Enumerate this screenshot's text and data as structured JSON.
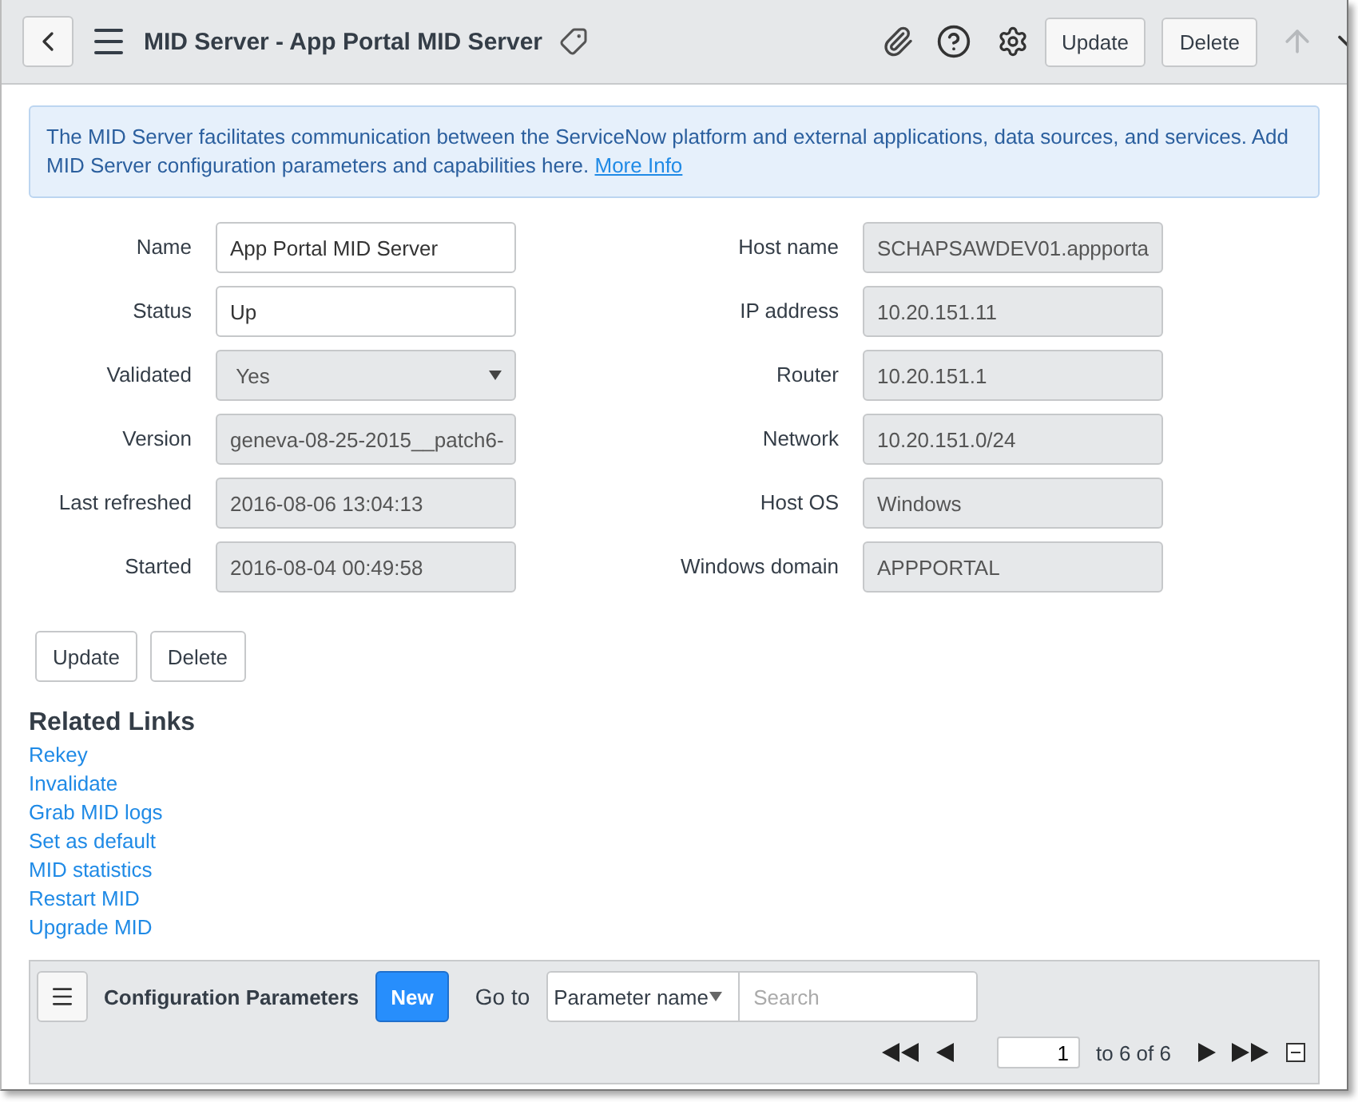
{
  "header": {
    "title": "MID Server - App Portal MID Server",
    "buttons": [
      "Update",
      "Delete"
    ]
  },
  "info": {
    "text": "The MID Server facilitates communication between the ServiceNow platform and external applications, data sources, and services. Add MID Server configuration parameters and capabilities here.",
    "link": "More Info"
  },
  "left_fields": [
    {
      "label": "Name",
      "value": "App Portal MID Server",
      "kind": "input"
    },
    {
      "label": "Status",
      "value": "Up",
      "kind": "input"
    },
    {
      "label": "Validated",
      "value": "Yes",
      "kind": "select"
    },
    {
      "label": "Version",
      "value": "geneva-08-25-2015__patch6-",
      "kind": "readonly"
    },
    {
      "label": "Last refreshed",
      "value": "2016-08-06 13:04:13",
      "kind": "readonly"
    },
    {
      "label": "Started",
      "value": "2016-08-04 00:49:58",
      "kind": "readonly"
    }
  ],
  "right_fields": [
    {
      "label": "Host name",
      "value": "SCHAPSAWDEV01.appporta",
      "kind": "readonly"
    },
    {
      "label": "IP address",
      "value": "10.20.151.11",
      "kind": "readonly"
    },
    {
      "label": "Router",
      "value": "10.20.151.1",
      "kind": "readonly"
    },
    {
      "label": "Network",
      "value": "10.20.151.0/24",
      "kind": "readonly"
    },
    {
      "label": "Host OS",
      "value": "Windows",
      "kind": "readonly"
    },
    {
      "label": "Windows domain",
      "value": "APPPORTAL",
      "kind": "readonly"
    }
  ],
  "form_buttons": [
    "Update",
    "Delete"
  ],
  "related_links": {
    "title": "Related Links",
    "items": [
      "Rekey",
      "Invalidate",
      "Grab MID logs",
      "Set as default",
      "MID statistics",
      "Restart MID",
      "Upgrade MID"
    ]
  },
  "list_panel": {
    "title": "Configuration Parameters",
    "new_button": "New",
    "goto_label": "Go to",
    "goto_field": "Parameter name",
    "search_placeholder": "Search",
    "page": "1",
    "range": "to 6 of 6"
  }
}
